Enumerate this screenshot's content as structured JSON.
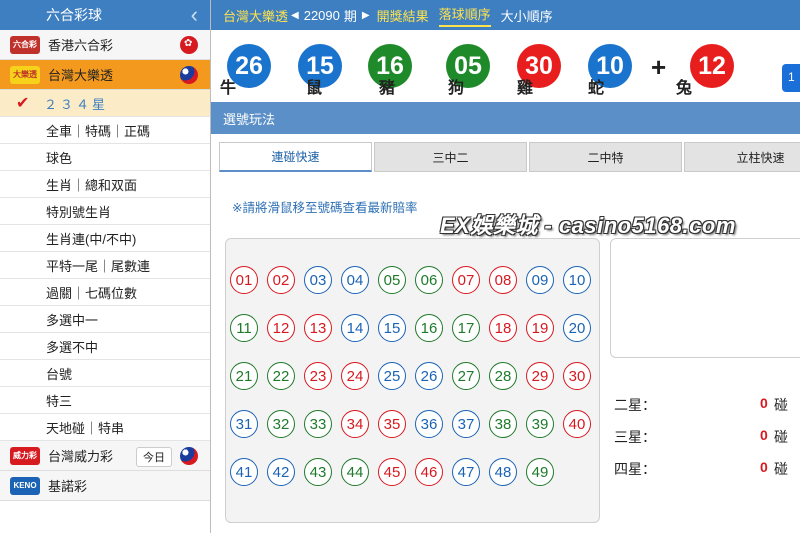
{
  "sidebar": {
    "title": "六合彩球",
    "lotteries": [
      {
        "name": "香港六合彩",
        "logo": "六合彩",
        "logo_color": "#c0312b",
        "flag": "hk-flag-icon"
      },
      {
        "name": "台灣大樂透",
        "logo": "大樂透",
        "logo_color": "#f6d21a",
        "flag": "tw-flag-icon",
        "active": true
      },
      {
        "name": "台灣威力彩",
        "logo": "威力彩",
        "logo_color": "#d71920",
        "flag": "tw-flag-icon",
        "badge": "今日"
      },
      {
        "name": "基諾彩",
        "logo": "KENO",
        "logo_color": "#1a63b5"
      }
    ],
    "subitems": [
      {
        "label": "２３４星",
        "selected": true
      },
      {
        "label": "全車｜特碼｜正碼"
      },
      {
        "label": "球色"
      },
      {
        "label": "生肖｜總和双面"
      },
      {
        "label": "特別號生肖"
      },
      {
        "label": "生肖連(中/不中)"
      },
      {
        "label": "平特一尾｜尾數連"
      },
      {
        "label": "過關｜七碼位數"
      },
      {
        "label": "多選中一"
      },
      {
        "label": "多選不中"
      },
      {
        "label": "台號"
      },
      {
        "label": "特三"
      },
      {
        "label": "天地碰｜特串"
      }
    ]
  },
  "topbar": {
    "lottery": "台灣大樂透",
    "period_num": "22090",
    "period_unit": "期",
    "results_link": "開獎結果",
    "tab_drop_order": "落球順序",
    "tab_size_order": "大小順序"
  },
  "results": {
    "balls": [
      {
        "num": "26",
        "zodiac": "牛",
        "color": "blue"
      },
      {
        "num": "15",
        "zodiac": "鼠",
        "color": "blue"
      },
      {
        "num": "16",
        "zodiac": "豬",
        "color": "green"
      },
      {
        "num": "05",
        "zodiac": "狗",
        "color": "green"
      },
      {
        "num": "30",
        "zodiac": "雞",
        "color": "red"
      },
      {
        "num": "10",
        "zodiac": "蛇",
        "color": "blue"
      }
    ],
    "plus": "+",
    "special": {
      "num": "12",
      "zodiac": "兔",
      "color": "red"
    },
    "edge_label": "1"
  },
  "section": {
    "title": "選號玩法"
  },
  "tabs": [
    "連碰快速",
    "三中二",
    "二中特",
    "立柱快速"
  ],
  "notice": "※請將滑鼠移至號碼查看最新賠率",
  "watermark": "EX娛樂城 - casino5168.com",
  "numbers": [
    {
      "n": "01",
      "c": "red"
    },
    {
      "n": "02",
      "c": "red"
    },
    {
      "n": "03",
      "c": "blue"
    },
    {
      "n": "04",
      "c": "blue"
    },
    {
      "n": "05",
      "c": "green"
    },
    {
      "n": "06",
      "c": "green"
    },
    {
      "n": "07",
      "c": "red"
    },
    {
      "n": "08",
      "c": "red"
    },
    {
      "n": "09",
      "c": "blue"
    },
    {
      "n": "10",
      "c": "blue"
    },
    {
      "n": "11",
      "c": "green"
    },
    {
      "n": "12",
      "c": "red"
    },
    {
      "n": "13",
      "c": "red"
    },
    {
      "n": "14",
      "c": "blue"
    },
    {
      "n": "15",
      "c": "blue"
    },
    {
      "n": "16",
      "c": "green"
    },
    {
      "n": "17",
      "c": "green"
    },
    {
      "n": "18",
      "c": "red"
    },
    {
      "n": "19",
      "c": "red"
    },
    {
      "n": "20",
      "c": "blue"
    },
    {
      "n": "21",
      "c": "green"
    },
    {
      "n": "22",
      "c": "green"
    },
    {
      "n": "23",
      "c": "red"
    },
    {
      "n": "24",
      "c": "red"
    },
    {
      "n": "25",
      "c": "blue"
    },
    {
      "n": "26",
      "c": "blue"
    },
    {
      "n": "27",
      "c": "green"
    },
    {
      "n": "28",
      "c": "green"
    },
    {
      "n": "29",
      "c": "red"
    },
    {
      "n": "30",
      "c": "red"
    },
    {
      "n": "31",
      "c": "blue"
    },
    {
      "n": "32",
      "c": "green"
    },
    {
      "n": "33",
      "c": "green"
    },
    {
      "n": "34",
      "c": "red"
    },
    {
      "n": "35",
      "c": "red"
    },
    {
      "n": "36",
      "c": "blue"
    },
    {
      "n": "37",
      "c": "blue"
    },
    {
      "n": "38",
      "c": "green"
    },
    {
      "n": "39",
      "c": "green"
    },
    {
      "n": "40",
      "c": "red"
    },
    {
      "n": "41",
      "c": "blue"
    },
    {
      "n": "42",
      "c": "blue"
    },
    {
      "n": "43",
      "c": "green"
    },
    {
      "n": "44",
      "c": "green"
    },
    {
      "n": "45",
      "c": "red"
    },
    {
      "n": "46",
      "c": "red"
    },
    {
      "n": "47",
      "c": "blue"
    },
    {
      "n": "48",
      "c": "blue"
    },
    {
      "n": "49",
      "c": "green"
    }
  ],
  "stats": [
    {
      "label": "二星：",
      "count": "0",
      "unit": "碰"
    },
    {
      "label": "三星：",
      "count": "0",
      "unit": "碰"
    },
    {
      "label": "四星：",
      "count": "0",
      "unit": "碰"
    }
  ],
  "colors": {
    "header_blue": "#3d7fc1",
    "active_orange": "#f39a1e",
    "ball_red": "#e81e1e",
    "ball_blue": "#1a73cc",
    "ball_green": "#1f8a2a"
  }
}
